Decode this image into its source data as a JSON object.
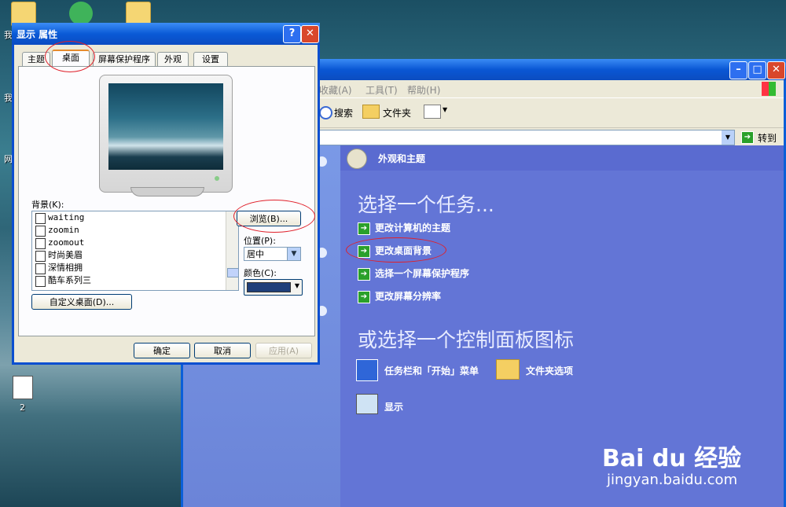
{
  "desktop": {
    "labels": [
      "我",
      "我",
      "网",
      "2"
    ]
  },
  "explorer": {
    "menu": [
      "收藏(A)",
      "工具(T)",
      "帮助(H)"
    ],
    "toolbar": {
      "search": "搜索",
      "folders": "文件夹"
    },
    "address": {
      "go": "转到"
    },
    "category_header": "外观和主题",
    "pick_task": "选择一个任务...",
    "tasks": [
      "更改计算机的主题",
      "更改桌面背景",
      "选择一个屏幕保护程序",
      "更改屏幕分辨率"
    ],
    "pick_icon": "或选择一个控制面板图标",
    "icons": [
      "任务栏和「开始」菜单",
      "文件夹选项",
      "显示"
    ]
  },
  "dialog": {
    "title": "显示 属性",
    "tabs": [
      "主题",
      "桌面",
      "屏幕保护程序",
      "外观",
      "设置"
    ],
    "background_label": "背景(K):",
    "backgrounds": [
      "waiting",
      "zoomin",
      "zoomout",
      "时尚美眉",
      "深情相拥",
      "酷车系列三"
    ],
    "browse": "浏览(B)...",
    "position_label": "位置(P):",
    "position_value": "居中",
    "color_label": "颜色(C):",
    "color_value": "#1f3f7a",
    "customize": "自定义桌面(D)...",
    "ok": "确定",
    "cancel": "取消",
    "apply": "应用(A)"
  },
  "watermark": {
    "brand": "Bai du 经验",
    "url": "jingyan.baidu.com"
  }
}
